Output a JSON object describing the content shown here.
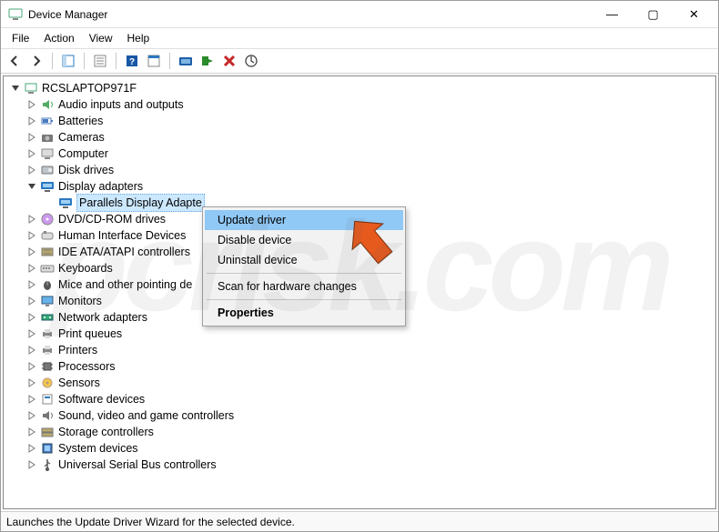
{
  "window": {
    "title": "Device Manager",
    "minimize_glyph": "—",
    "maximize_glyph": "▢",
    "close_glyph": "✕"
  },
  "menu": {
    "items": [
      "File",
      "Action",
      "View",
      "Help"
    ]
  },
  "tree": {
    "root": "RCSLAPTOP971F",
    "nodes": [
      {
        "label": "Audio inputs and outputs",
        "icon": "audio-icon"
      },
      {
        "label": "Batteries",
        "icon": "battery-icon"
      },
      {
        "label": "Cameras",
        "icon": "camera-icon"
      },
      {
        "label": "Computer",
        "icon": "computer-icon"
      },
      {
        "label": "Disk drives",
        "icon": "disk-icon"
      },
      {
        "label": "Display adapters",
        "icon": "display-icon",
        "expanded": true,
        "children": [
          {
            "label": "Parallels Display Adapte",
            "icon": "display-icon",
            "selected": true
          }
        ]
      },
      {
        "label": "DVD/CD-ROM drives",
        "icon": "dvd-icon"
      },
      {
        "label": "Human Interface Devices",
        "icon": "hid-icon"
      },
      {
        "label": "IDE ATA/ATAPI controllers",
        "icon": "ide-icon"
      },
      {
        "label": "Keyboards",
        "icon": "keyboard-icon"
      },
      {
        "label": "Mice and other pointing de",
        "icon": "mouse-icon"
      },
      {
        "label": "Monitors",
        "icon": "monitor-icon"
      },
      {
        "label": "Network adapters",
        "icon": "network-icon"
      },
      {
        "label": "Print queues",
        "icon": "printer-icon"
      },
      {
        "label": "Printers",
        "icon": "printer-icon"
      },
      {
        "label": "Processors",
        "icon": "cpu-icon"
      },
      {
        "label": "Sensors",
        "icon": "sensor-icon"
      },
      {
        "label": "Software devices",
        "icon": "software-icon"
      },
      {
        "label": "Sound, video and game controllers",
        "icon": "sound-icon"
      },
      {
        "label": "Storage controllers",
        "icon": "storage-icon"
      },
      {
        "label": "System devices",
        "icon": "system-icon"
      },
      {
        "label": "Universal Serial Bus controllers",
        "icon": "usb-icon"
      }
    ]
  },
  "context_menu": {
    "items": [
      {
        "label": "Update driver",
        "highlight": true
      },
      {
        "label": "Disable device"
      },
      {
        "label": "Uninstall device"
      },
      {
        "sep": true
      },
      {
        "label": "Scan for hardware changes"
      },
      {
        "sep": true
      },
      {
        "label": "Properties",
        "bold": true
      }
    ]
  },
  "statusbar": {
    "text": "Launches the Update Driver Wizard for the selected device."
  },
  "watermark": {
    "text": "pcrisk.com"
  }
}
